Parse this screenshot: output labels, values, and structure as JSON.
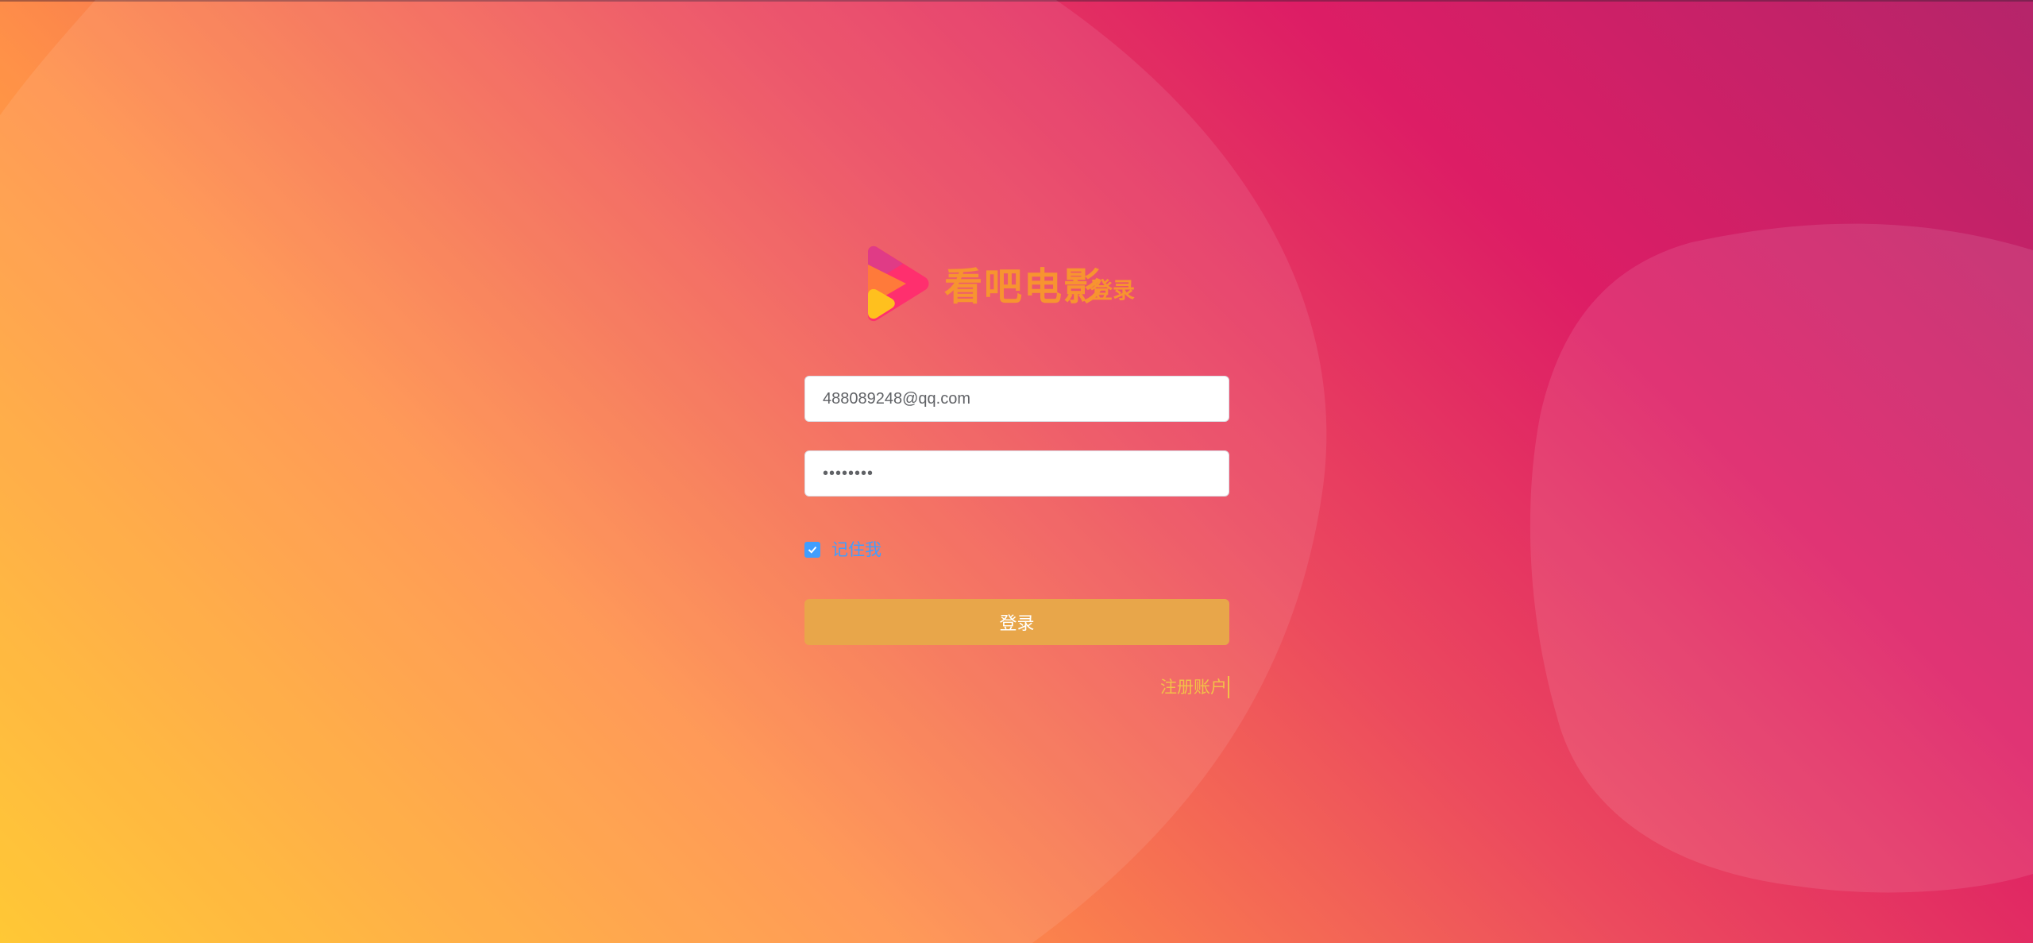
{
  "app": {
    "brand_name": "看吧电影",
    "brand_subtitle": "登录",
    "logo_icon": "play-triangle-logo-icon"
  },
  "login_form": {
    "email_value": "488089248@qq.com",
    "password_value": "********",
    "remember_checked": true,
    "remember_label": "记住我",
    "submit_label": "登录",
    "register_label": "注册账户"
  },
  "colors": {
    "brand_orange": "#f79430",
    "button": "#e8a64a",
    "checkbox_blue": "#409eff",
    "register_link": "#f3c048",
    "bg_top_right": "#b5256a",
    "bg_bottom_left": "#ffc322"
  }
}
